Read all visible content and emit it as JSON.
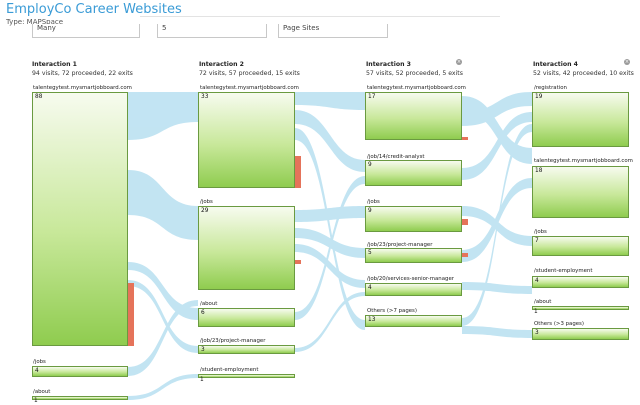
{
  "header": {
    "title": "EmployCo Career Websites",
    "type_label": "Type: MAPSpace"
  },
  "filters": [
    {
      "value": "Many"
    },
    {
      "value": "5"
    },
    {
      "value": "Page Sites"
    }
  ],
  "colors": {
    "title": "#3a9bd6",
    "flow": "#bfe3f2",
    "node_top": "#f7fbef",
    "node_bottom": "#8fcc4f",
    "node_border": "#6a9a40",
    "exit": "#e5735a"
  },
  "columns": [
    {
      "title": "Interaction 1",
      "stats": "94 visits, 72 proceeded, 22 exits",
      "nodes": [
        {
          "label": "talentegytest.mysmartjobboard.com",
          "count": "88"
        },
        {
          "label": "/jobs",
          "count": "4"
        },
        {
          "label": "/about",
          "count": "1"
        }
      ]
    },
    {
      "title": "Interaction 2",
      "stats": "72 visits, 57 proceeded, 15 exits",
      "nodes": [
        {
          "label": "talentegytest.mysmartjobboard.com",
          "count": "33"
        },
        {
          "label": "/jobs",
          "count": "29"
        },
        {
          "label": "/about",
          "count": "6"
        },
        {
          "label": "/job/23/project-manager",
          "count": "3"
        },
        {
          "label": "/student-employment",
          "count": "1"
        }
      ]
    },
    {
      "title": "Interaction 3",
      "stats": "57 visits, 52 proceeded, 5 exits",
      "nodes": [
        {
          "label": "talentegytest.mysmartjobboard.com",
          "count": "17"
        },
        {
          "label": "/job/14/credit-analyst",
          "count": "9"
        },
        {
          "label": "/jobs",
          "count": "9"
        },
        {
          "label": "/job/23/project-manager",
          "count": "5"
        },
        {
          "label": "/job/20/services-senior-manager",
          "count": "4"
        },
        {
          "label": "Others (>7 pages)",
          "count": "13"
        }
      ]
    },
    {
      "title": "Interaction 4",
      "stats": "52 visits, 42 proceeded, 10 exits",
      "nodes": [
        {
          "label": "/registration",
          "count": "19"
        },
        {
          "label": "talentegytest.mysmartjobboard.com",
          "count": "18"
        },
        {
          "label": "/jobs",
          "count": "7"
        },
        {
          "label": "/student-employment",
          "count": "4"
        },
        {
          "label": "/about",
          "count": "1"
        },
        {
          "label": "Others (>3 pages)",
          "count": "3"
        }
      ]
    }
  ]
}
